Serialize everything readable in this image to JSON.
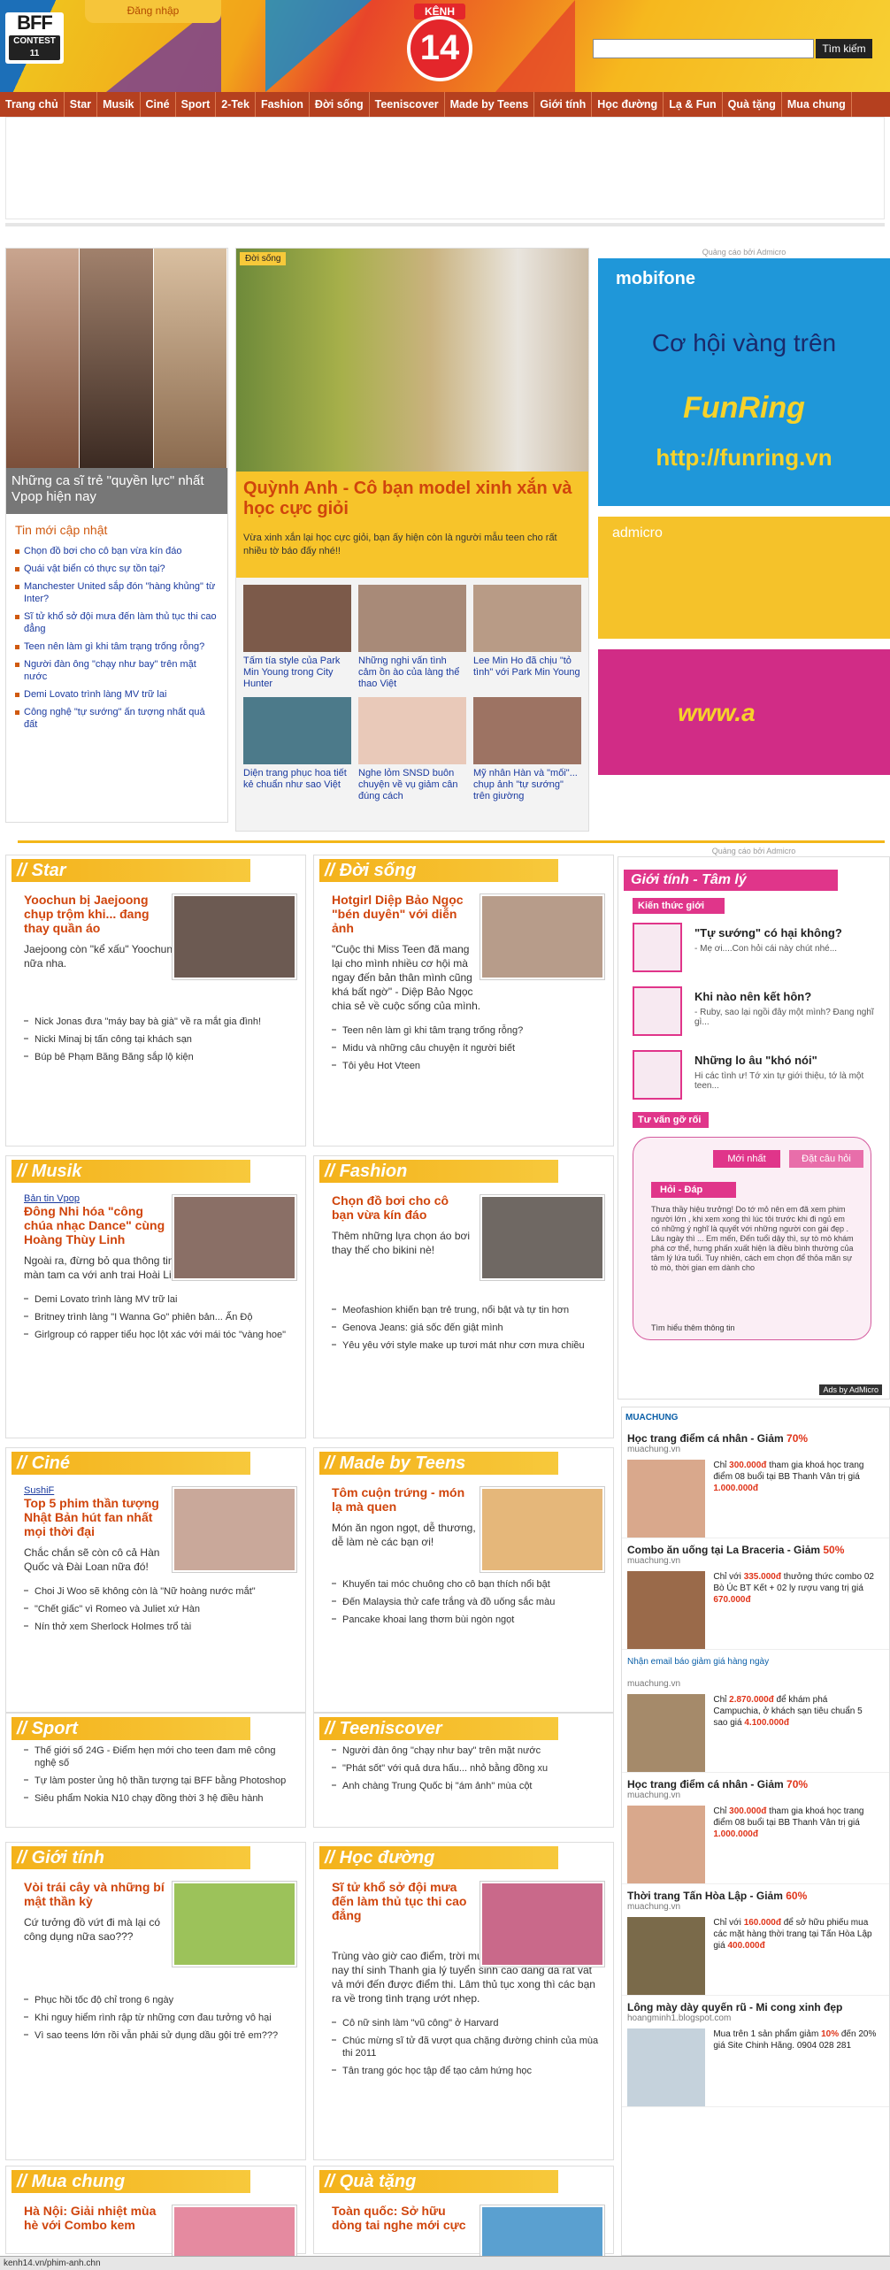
{
  "header": {
    "login": "Đăng nhập",
    "bff_line1": "BFF",
    "bff_line2": "CONTEST 11",
    "logo_top": "KÊNH",
    "logo_num": "14",
    "search_button": "Tìm kiếm"
  },
  "nav": [
    "Trang chủ",
    "Star",
    "Musik",
    "Ciné",
    "Sport",
    "2-Tek",
    "Fashion",
    "Đời sống",
    "Teeniscover",
    "Made by Teens",
    "Giới tính",
    "Học đường",
    "Lạ & Fun",
    "Quà tặng",
    "Mua chung"
  ],
  "left": {
    "caption": "Những ca sĩ trẻ \"quyền lực\" nhất Vpop hiện nay",
    "updates_title": "Tin mới cập nhật",
    "updates": [
      "Chọn đồ bơi cho cô bạn vừa kín đáo",
      "Quái vật biển có thực sự tồn tại?",
      "Manchester United sắp đón \"hàng khủng\" từ Inter?",
      "Sĩ tử khổ sở đội mưa đến làm thủ tục thi cao đẳng",
      "Teen nên làm gì khi tâm trạng trống rỗng?",
      "Người đàn ông \"chạy như bay\" trên mặt nước",
      "Demi Lovato trình làng MV trữ lai",
      "Công nghệ \"tự sướng\" ấn tượng nhất quả đất"
    ]
  },
  "feature": {
    "tag": "Đời sống",
    "title": "Quỳnh Anh - Cô bạn model xinh xắn và học cực giỏi",
    "desc": "Vừa xinh xắn lại học cực giỏi, bạn ấy hiện còn là người mẫu teen cho rất nhiều tờ báo đấy nhé!!",
    "items": [
      "Tấm tía style của Park Min Young trong City Hunter",
      "Những nghi vấn tình cảm ồn ào của làng thể thao Việt",
      "Lee Min Ho đã chịu \"tỏ tình\" với Park Min Young",
      "Diện trang phục hoa tiết kẻ chuẩn như sao Việt",
      "Nghe lỏm SNSD buôn chuyện về vụ giảm cân đúng cách",
      "Mỹ nhân Hàn và \"mối\"... chụp ảnh \"tự sướng\" trên giường"
    ]
  },
  "ads": {
    "label": "Quảng cáo bởi Admicro",
    "mobifone": "mobifone",
    "co_hoi": "Cơ hội vàng trên",
    "funring": "FunRing",
    "url": "http://funring.vn",
    "admicro": "admicro",
    "www": "www.a"
  },
  "sections": [
    {
      "title": "// Star",
      "src": "",
      "headline": "Yoochun bị Jaejoong chụp trộm khi... đang thay quần áo",
      "desc": "Jaejoong còn \"kể xấu\" Yoochun nữa nha.",
      "links": [
        "Nick Jonas đưa \"máy bay bà già\" về ra mắt gia đình!",
        "Nicki Minaj bị tấn công tại khách sạn",
        "Búp bê Phạm Băng Băng sắp lộ kiện"
      ]
    },
    {
      "title": "// Đời sống",
      "src": "",
      "headline": "Hotgirl Diệp Bảo Ngọc \"bén duyên\" với diễn ảnh",
      "desc": "\"Cuộc thi Miss Teen đã mang lại cho mình nhiều cơ hội mà ngay đến bản thân mình cũng khá bất ngờ\" - Diệp Bảo Ngọc chia sẻ về cuộc sống của mình.",
      "links": [
        "Teen nên làm gì khi tâm trạng trống rỗng?",
        "Midu và những câu chuyện ít người biết",
        "Tôi yêu Hot Vteen"
      ]
    },
    {
      "title": "// Musik",
      "src": "Bản tin Vpop",
      "headline": "Đông Nhi hóa \"công chúa nhạc Dance\" cùng Hoàng Thùy Linh",
      "desc": "Ngoài ra, đừng bỏ qua thông tin Dương Triệu Vũ sẽ có màn tam ca với anh trai Hoài Linh và Mr. Đàm.",
      "links": [
        "Demi Lovato trình làng MV trữ lai",
        "Britney trình làng \"I Wanna Go\" phiên bản... Ấn Độ",
        "Girlgroup có rapper tiểu học lột xác với mái tóc \"vàng hoe\""
      ]
    },
    {
      "title": "// Fashion",
      "src": "",
      "headline": "Chọn đồ bơi cho cô bạn vừa kín đáo",
      "desc": "Thêm những lựa chọn áo bơi thay thế cho bikini nè!",
      "links": [
        "Meofashion khiến bạn trẻ trung, nổi bật và tự tin hơn",
        "Genova Jeans: giá sốc đến giật mình",
        "Yêu yêu với style make up tươi mát như cơn mưa chiều"
      ]
    },
    {
      "title": "// Ciné",
      "src": "SushiF",
      "headline": "Top 5 phim thần tượng Nhật Bản hút fan nhất mọi thời đại",
      "desc": "Chắc chắn sẽ còn cô cả Hàn Quốc và Đài Loan nữa đó!",
      "links": [
        "Choi Ji Woo sẽ không còn là \"Nữ hoàng nước mắt\"",
        "\"Chết giấc\" vì Romeo và Juliet xứ Hàn",
        "Nín thở xem Sherlock Holmes trổ tài"
      ]
    },
    {
      "title": "// Made by Teens",
      "src": "",
      "headline": "Tôm cuộn trứng - món lạ mà quen",
      "desc": "Món ăn ngon ngọt, dễ thương, dễ làm nè các bạn ơi!",
      "links": [
        "Khuyến tai móc chuông cho cô bạn thích nổi bật",
        "Đến Malaysia thử cafe trắng và đồ uống sắc màu",
        "Pancake khoai lang thơm bùi ngòn ngọt"
      ]
    },
    {
      "title": "// Sport",
      "src": "",
      "headline": "",
      "desc": "",
      "links": [
        "Thế giới số 24G - Điểm hẹn mới cho teen đam mê công nghệ số",
        "Tự làm poster ủng hộ thần tượng tại BFF bằng Photoshop",
        "Siêu phẩm Nokia N10 chạy đồng thời 3 hệ điều hành"
      ]
    },
    {
      "title": "// Teeniscover",
      "src": "",
      "headline": "",
      "desc": "",
      "links": [
        "Người đàn ông \"chạy như bay\" trên mặt nước",
        "\"Phát sốt\" với quả dưa hấu... nhỏ bằng đồng xu",
        "Anh chàng Trung Quốc bị \"ám ảnh\" mùa cột"
      ]
    },
    {
      "title": "// Giới tính",
      "src": "",
      "headline": "Vòi trái cây và những bí mật thần kỳ",
      "desc": "Cứ tưởng đồ vứt đi mà lại có công dụng nữa sao???",
      "links": [
        "Phục hồi tốc độ chỉ trong 6 ngày",
        "Khi nguy hiểm rình rập từ những cơn đau tưởng vô hại",
        "Vì sao teens lớn rồi vẫn phải sử dụng dầu gội trẻ em???"
      ]
    },
    {
      "title": "// Học đường",
      "src": "",
      "headline": "Sĩ tử khổ sở đội mưa đến làm thủ tục thi cao đẳng",
      "desc": "Trùng vào giờ cao điểm, trời mưa, đường tắc nên sáng nay thí sinh Thanh gia lý tuyển sinh cao đẳng đã rất vất vả mới đến được điểm thi. Lâm thủ tục xong thì các bạn ra về trong tình trạng ướt nhẹp.",
      "links": [
        "Cô nữ sinh làm \"vũ công\" ở Harvard",
        "Chúc mừng sĩ tử đã vượt qua chặng đường chinh của mùa thi 2011",
        "Tân trang góc học tập để tạo cảm hứng học"
      ]
    },
    {
      "title": "// Mua chung",
      "src": "",
      "headline": "Hà Nội: Giải nhiệt mùa hè với Combo kem",
      "desc": "",
      "links": []
    },
    {
      "title": "// Quà tặng",
      "src": "",
      "headline": "Toàn quốc: Sở hữu dòng tai nghe mới cực",
      "desc": "",
      "links": []
    }
  ],
  "gioitinh": {
    "label": "Quảng cáo bởi Admicro",
    "title": "Giới tính - Tâm lý",
    "sub": "Kiến thức giới tính",
    "qs": [
      {
        "h": "\"Tự sướng\" có hại không?",
        "p": "- Mẹ ơi....Con hỏi cái này chút nhé..."
      },
      {
        "h": "Khi nào nên kết hôn?",
        "p": "- Ruby, sao lại ngồi đây một mình? Đang nghĩ gì..."
      },
      {
        "h": "Những lo âu \"khó nói\"",
        "p": "Hi các tình ư! Tớ xin tự giới thiệu, tớ là một teen..."
      }
    ],
    "tuvan": "Tư vấn gỡ rối",
    "tab1": "Mới nhất",
    "tab2": "Đặt câu hỏi",
    "hoidap": "Hỏi - Đáp",
    "qa": "Thưa thầy hiệu trưởng! Do tớ mỏ nên em đã xem phim người lớn , khi xem xong thì lúc tôi trước khi đi ngủ em có những ý nghĩ là quyết với những người con gái đẹp . Lâu ngày thì ... Em mến, Đến tuổi dậy thì, sự tò mò khám phá cơ thể, hưng phấn xuất hiện là điều bình thường của tâm lý lứa tuổi. Tuy nhiên, cách em chọn để thỏa mãn sự tò mò, thời gian em dành cho",
    "foot": "Tìm hiểu thêm thông tin",
    "ads": "Ads by AdMicro"
  },
  "muachung": {
    "logo": "MUACHUNG",
    "items": [
      {
        "title": "Học trang điểm cá nhân - Giảm ",
        "pct": "70%",
        "site": "muachung.vn",
        "price": "300.000đ",
        "text": " tham gia khoá học trang điểm 08 buổi tại BB Thanh Vân trị giá ",
        "orig": "1.000.000đ",
        "pre": "Chỉ "
      },
      {
        "title": "Combo ăn uống tại La Braceria - Giảm ",
        "pct": "50%",
        "site": "muachung.vn",
        "price": "335.000đ",
        "text": " thưởng thức combo 02 Bò Úc BT Kết + 02 ly rượu vang trị giá ",
        "orig": "670.000đ",
        "pre": "Chỉ với "
      }
    ],
    "newsletter": "Nhận email báo giảm giá hàng ngày",
    "items2": [
      {
        "title": "",
        "pct": "",
        "site": "muachung.vn",
        "price": "2.870.000đ",
        "text": " để khám phá Campuchia, ở khách sạn tiêu chuẩn 5 sao giá ",
        "orig": "4.100.000đ",
        "pre": "Chỉ "
      },
      {
        "title": "Học trang điểm cá nhân - Giảm ",
        "pct": "70%",
        "site": "muachung.vn",
        "price": "300.000đ",
        "text": " tham gia khoá học trang điểm 08 buổi tại BB Thanh Vân trị giá ",
        "orig": "1.000.000đ",
        "pre": "Chỉ "
      },
      {
        "title": "Thời trang Tấn Hòa Lập - Giảm ",
        "pct": "60%",
        "site": "muachung.vn",
        "price": "160.000đ",
        "text": " để sở hữu phiếu mua các mặt hàng thời trang tại Tấn Hòa Lập giá ",
        "orig": "400.000đ",
        "pre": "Chỉ với "
      },
      {
        "title": "Lông mày dày quyến rũ - Mi cong xinh đẹp",
        "pct": "",
        "site": "hoangminh1.blogspot.com",
        "price": "10%",
        "text": " đến 20% giá Site Chinh Hãng. 0904 028 281",
        "orig": "",
        "pre": "Mua trên 1 sản phẩm giảm "
      }
    ]
  },
  "status": "kenh14.vn/phim-anh.chn"
}
